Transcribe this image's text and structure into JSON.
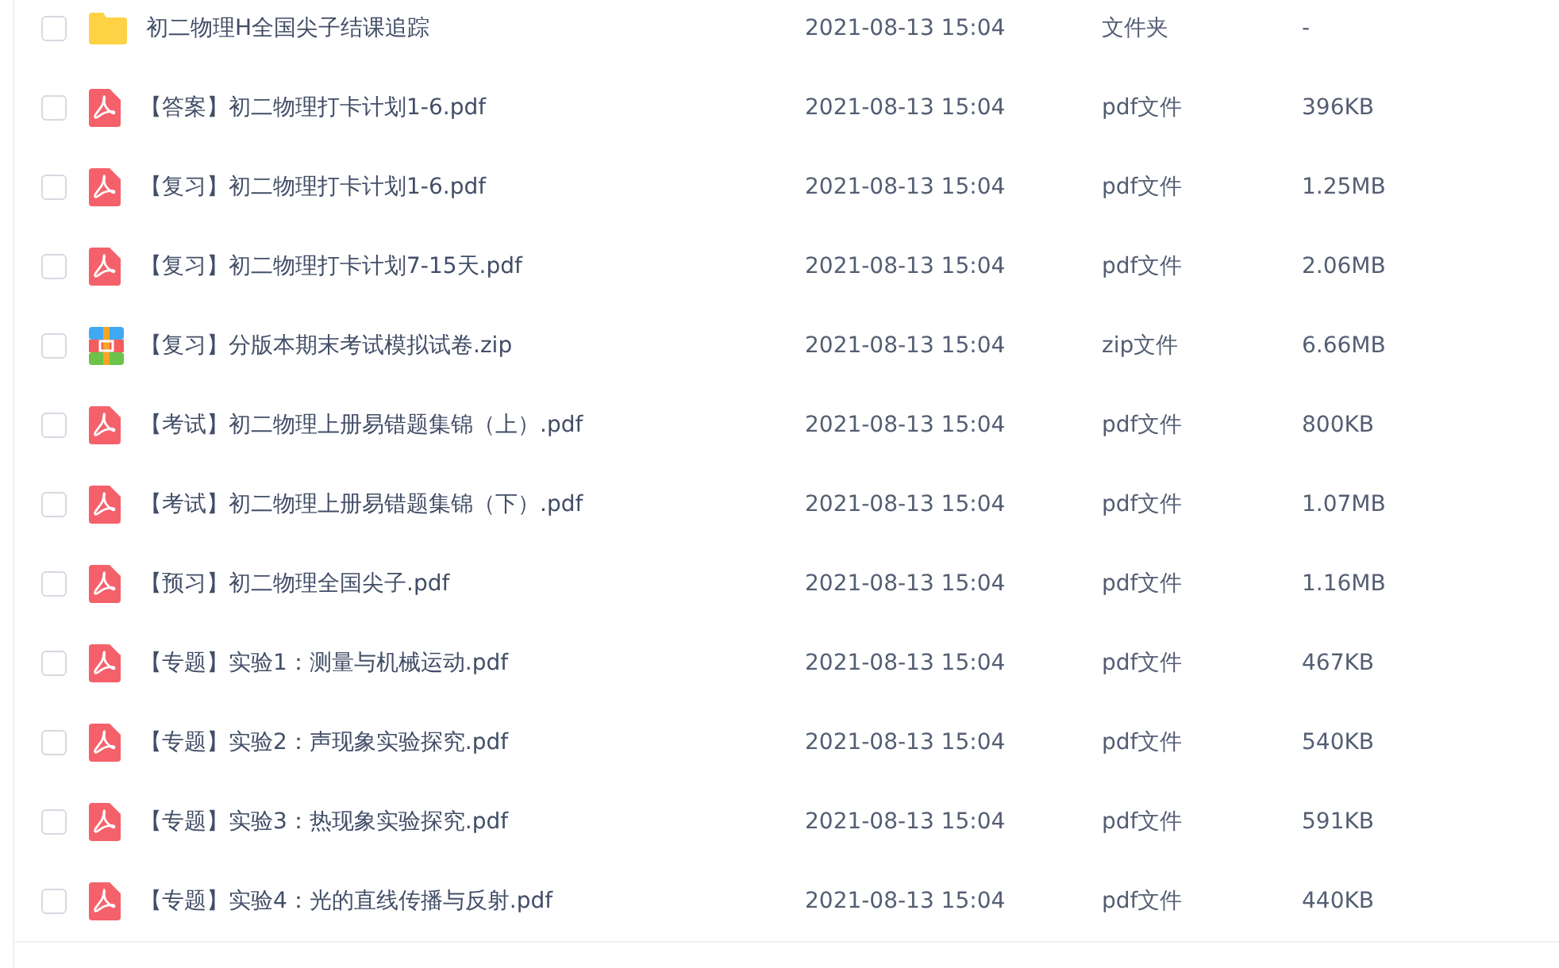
{
  "files": [
    {
      "kind": "folder",
      "checked": false,
      "name": "初二物理H全国尖子结课追踪",
      "modified": "2021-08-13 15:04",
      "type": "文件夹",
      "size": "-"
    },
    {
      "kind": "pdf",
      "checked": false,
      "name": "【答案】初二物理打卡计划1-6.pdf",
      "modified": "2021-08-13 15:04",
      "type": "pdf文件",
      "size": "396KB"
    },
    {
      "kind": "pdf",
      "checked": false,
      "name": "【复习】初二物理打卡计划1-6.pdf",
      "modified": "2021-08-13 15:04",
      "type": "pdf文件",
      "size": "1.25MB"
    },
    {
      "kind": "pdf",
      "checked": false,
      "name": "【复习】初二物理打卡计划7-15天.pdf",
      "modified": "2021-08-13 15:04",
      "type": "pdf文件",
      "size": "2.06MB"
    },
    {
      "kind": "zip",
      "checked": false,
      "name": "【复习】分版本期末考试模拟试卷.zip",
      "modified": "2021-08-13 15:04",
      "type": "zip文件",
      "size": "6.66MB"
    },
    {
      "kind": "pdf",
      "checked": false,
      "name": "【考试】初二物理上册易错题集锦（上）.pdf",
      "modified": "2021-08-13 15:04",
      "type": "pdf文件",
      "size": "800KB"
    },
    {
      "kind": "pdf",
      "checked": false,
      "name": "【考试】初二物理上册易错题集锦（下）.pdf",
      "modified": "2021-08-13 15:04",
      "type": "pdf文件",
      "size": "1.07MB"
    },
    {
      "kind": "pdf",
      "checked": false,
      "name": "【预习】初二物理全国尖子.pdf",
      "modified": "2021-08-13 15:04",
      "type": "pdf文件",
      "size": "1.16MB"
    },
    {
      "kind": "pdf",
      "checked": false,
      "name": "【专题】实验1：测量与机械运动.pdf",
      "modified": "2021-08-13 15:04",
      "type": "pdf文件",
      "size": "467KB"
    },
    {
      "kind": "pdf",
      "checked": false,
      "name": "【专题】实验2：声现象实验探究.pdf",
      "modified": "2021-08-13 15:04",
      "type": "pdf文件",
      "size": "540KB"
    },
    {
      "kind": "pdf",
      "checked": false,
      "name": "【专题】实验3：热现象实验探究.pdf",
      "modified": "2021-08-13 15:04",
      "type": "pdf文件",
      "size": "591KB"
    },
    {
      "kind": "pdf",
      "checked": false,
      "name": "【专题】实验4：光的直线传播与反射.pdf",
      "modified": "2021-08-13 15:04",
      "type": "pdf文件",
      "size": "440KB"
    }
  ]
}
